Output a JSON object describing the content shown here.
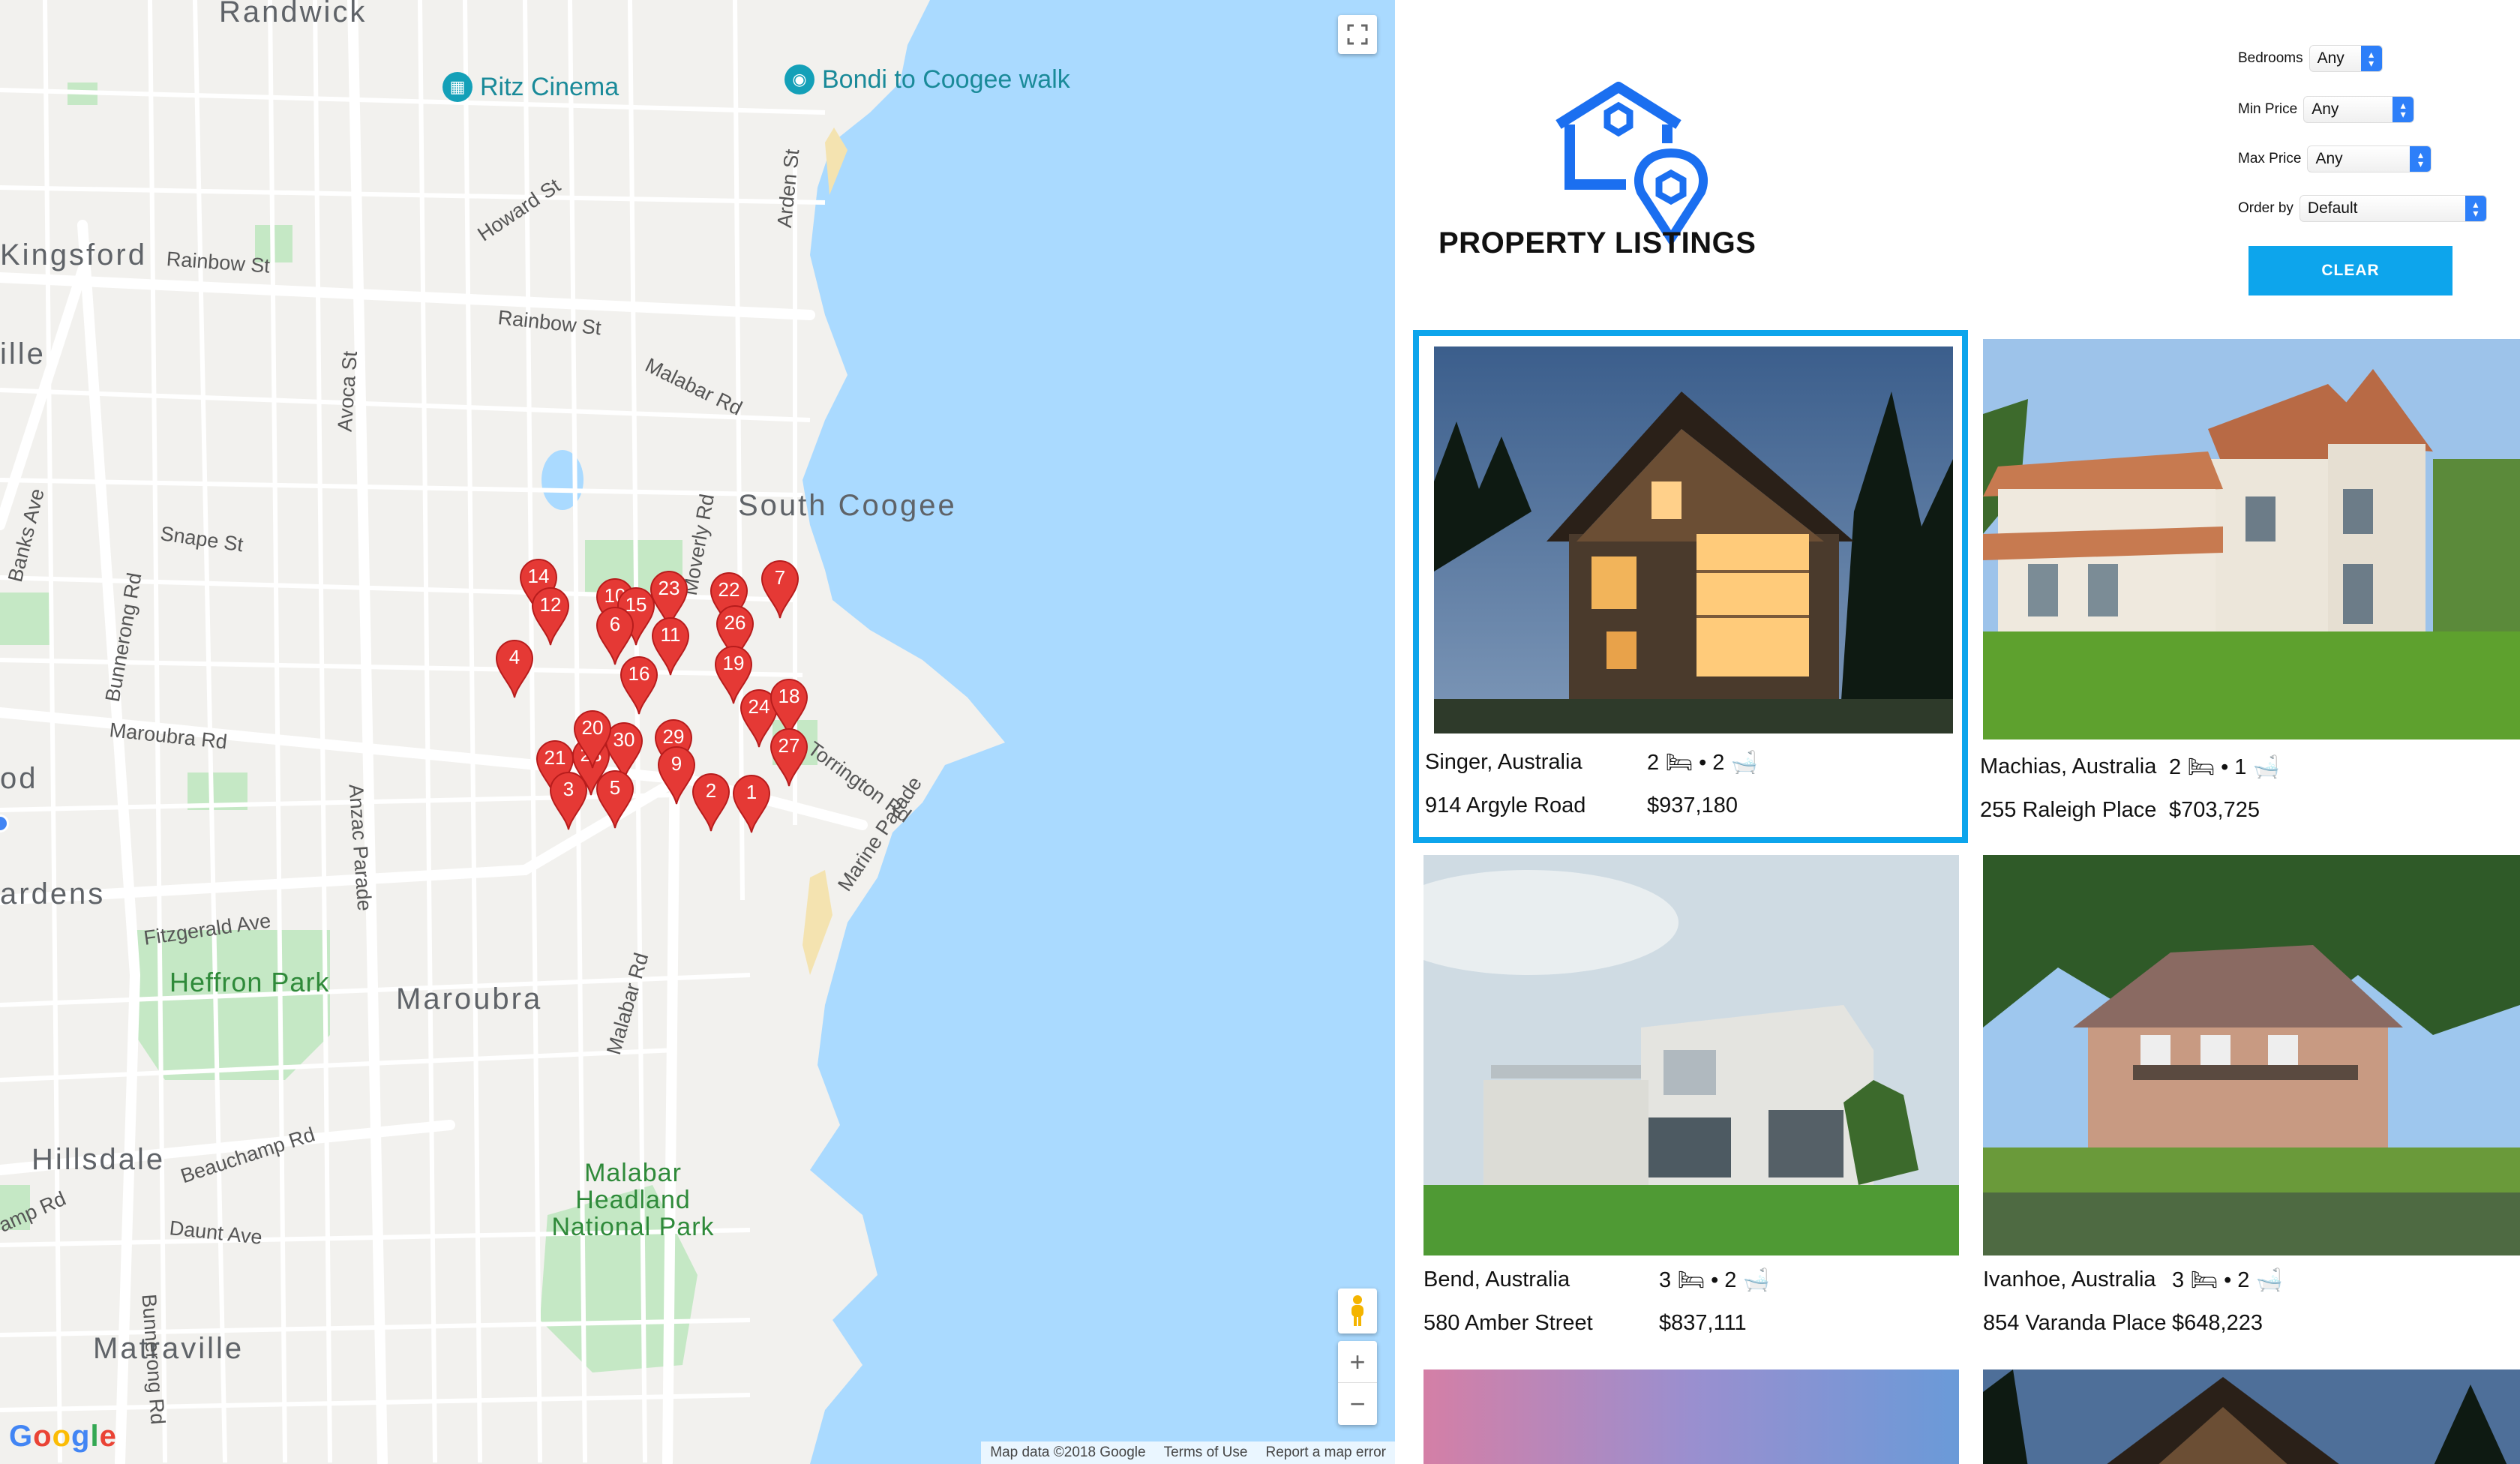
{
  "map": {
    "places": {
      "randwick": "Randwick",
      "kingsford": "Kingsford",
      "ille": "ille",
      "od": "od",
      "south_coogee": "South Coogee",
      "ardens": "ardens",
      "maroubra": "Maroubra",
      "hillsdale": "Hillsdale",
      "matraville": "Matraville"
    },
    "parks": {
      "heffron": "Heffron Park",
      "malabar": "Malabar Headland National Park"
    },
    "pois": {
      "ritz": "Ritz Cinema",
      "bondi": "Bondi to Coogee walk"
    },
    "roads": {
      "rainbow1": "Rainbow St",
      "rainbow2": "Rainbow St",
      "howard": "Howard St",
      "arden": "Arden St",
      "avoca": "Avoca St",
      "malabar_rd": "Malabar Rd",
      "malabar_rd2": "Malabar Rd",
      "snape": "Snape St",
      "banks": "Banks Ave",
      "bunnerong": "Bunnerong Rd",
      "bunnerong2": "Bunnerong Rd",
      "maroubra_rd": "Maroubra Rd",
      "anzac": "Anzac Parade",
      "moverly": "Moverly Rd",
      "torrington": "Torrington Rd",
      "marine": "Marine Parade",
      "fitzgerald": "Fitzgerald Ave",
      "beauchamp": "Beauchamp Rd",
      "daunt": "Daunt Ave",
      "amp": "amp Rd"
    },
    "markers": [
      "14",
      "12",
      "4",
      "10",
      "15",
      "6",
      "23",
      "11",
      "16",
      "22",
      "26",
      "19",
      "7",
      "24",
      "18",
      "27",
      "29",
      "30",
      "28",
      "21",
      "3",
      "5",
      "20",
      "9",
      "2",
      "1"
    ],
    "attribution": {
      "data": "Map data ©2018 Google",
      "terms": "Terms of Use",
      "report": "Report a map error"
    },
    "google_logo": "Google",
    "zoom_in": "+",
    "zoom_out": "−"
  },
  "header": {
    "title": "PROPERTY LISTINGS",
    "brand_color": "#1b6ff0"
  },
  "filters": {
    "bedrooms": {
      "label": "Bedrooms",
      "value": "Any"
    },
    "min_price": {
      "label": "Min Price",
      "value": "Any"
    },
    "max_price": {
      "label": "Max Price",
      "value": "Any"
    },
    "order_by": {
      "label": "Order by",
      "value": "Default"
    },
    "clear": "CLEAR"
  },
  "accent": "#0da5ec",
  "listings": [
    {
      "city": "Singer, Australia",
      "street": "914 Argyle Road",
      "beds": "2",
      "baths": "2",
      "price": "$937,180",
      "selected": true
    },
    {
      "city": "Machias, Australia",
      "street": "255 Raleigh Place",
      "beds": "2",
      "baths": "1",
      "price": "$703,725",
      "selected": false
    },
    {
      "city": "Bend, Australia",
      "street": "580 Amber Street",
      "beds": "3",
      "baths": "2",
      "price": "$837,111",
      "selected": false
    },
    {
      "city": "Ivanhoe, Australia",
      "street": "854 Varanda Place",
      "beds": "3",
      "baths": "2",
      "price": "$648,223",
      "selected": false
    }
  ],
  "listing_separator": "•"
}
